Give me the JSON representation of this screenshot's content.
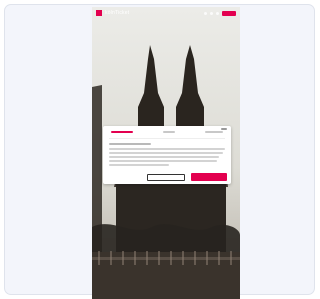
{
  "topbar": {
    "logo_text": "kölnTicket"
  },
  "colors": {
    "accent": "#e3004f",
    "frame_background": "#f3f5fb"
  },
  "icons": {
    "logo": "logo-mark",
    "top_icons": [
      "dot-icon",
      "dot-icon",
      "user-icon"
    ],
    "cta": "primary-top-button"
  },
  "cookie_modal": {
    "tabs": [
      "",
      "",
      ""
    ],
    "buttons": {
      "secondary": "",
      "primary": ""
    }
  }
}
